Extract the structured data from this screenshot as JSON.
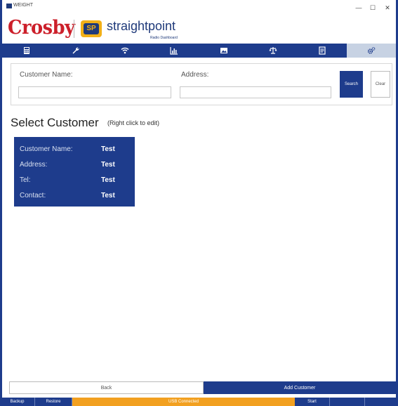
{
  "window": {
    "title": "WEIGHT",
    "controls": {
      "minimize": "—",
      "maximize": "☐",
      "close": "✕"
    }
  },
  "brand": {
    "crosby": "Crosby",
    "straightpoint": "straightpoint",
    "sp_badge": "SP",
    "tagline": "Radio Dashboard"
  },
  "nav": {
    "tabs": [
      {
        "icon": "calculator-icon",
        "active": false
      },
      {
        "icon": "wrench-icon",
        "active": false
      },
      {
        "icon": "wifi-icon",
        "active": false
      },
      {
        "icon": "chart-icon",
        "active": false
      },
      {
        "icon": "image-icon",
        "active": false
      },
      {
        "icon": "scale-icon",
        "active": false
      },
      {
        "icon": "document-icon",
        "active": false
      },
      {
        "icon": "gears-icon",
        "active": true
      }
    ]
  },
  "search": {
    "customer_label": "Customer Name:",
    "address_label": "Address:",
    "customer_value": "",
    "address_value": "",
    "search_button": "Search",
    "clear_button": "Clear"
  },
  "customers": {
    "title": "Select Customer",
    "hint": "(Right click to edit)",
    "card": {
      "rows": [
        {
          "key": "Customer Name:",
          "value": "Test"
        },
        {
          "key": "Address:",
          "value": "Test"
        },
        {
          "key": "Tel:",
          "value": "Test"
        },
        {
          "key": "Contact:",
          "value": "Test"
        }
      ]
    }
  },
  "footer": {
    "back_button": "Back",
    "add_button": "Add Customer"
  },
  "status": {
    "backup": "Backup",
    "restore": "Restore",
    "usb": "USB Connected",
    "start": "Start"
  },
  "colors": {
    "primary": "#1e3c8c",
    "crosby_red": "#cc1f2a",
    "sp_yellow": "#f2b018",
    "usb_orange": "#f2a020"
  }
}
